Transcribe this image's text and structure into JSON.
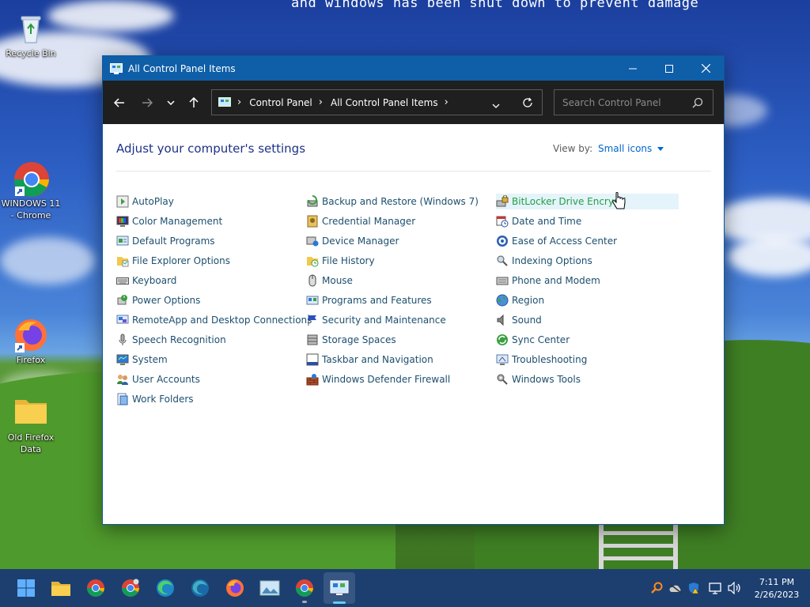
{
  "desktop": {
    "bsod_text": "and windows has been shut down to prevent damage",
    "icons": [
      {
        "label": "Recycle Bin"
      },
      {
        "label": "WINDOWS 11 - Chrome"
      },
      {
        "label": "Firefox"
      },
      {
        "label": "Old Firefox Data"
      }
    ]
  },
  "window": {
    "title": "All Control Panel Items",
    "breadcrumb": [
      "Control Panel",
      "All Control Panel Items"
    ],
    "search_placeholder": "Search Control Panel",
    "heading": "Adjust your computer's settings",
    "view_by_label": "View by:",
    "view_by_value": "Small icons",
    "columns": [
      [
        "AutoPlay",
        "Color Management",
        "Default Programs",
        "File Explorer Options",
        "Keyboard",
        "Power Options",
        "RemoteApp and Desktop Connections",
        "Speech Recognition",
        "System",
        "User Accounts",
        "Work Folders"
      ],
      [
        "Backup and Restore (Windows 7)",
        "Credential Manager",
        "Device Manager",
        "File History",
        "Mouse",
        "Programs and Features",
        "Security and Maintenance",
        "Storage Spaces",
        "Taskbar and Navigation",
        "Windows Defender Firewall"
      ],
      [
        "BitLocker Drive Encrypti",
        "Date and Time",
        "Ease of Access Center",
        "Indexing Options",
        "Phone and Modem",
        "Region",
        "Sound",
        "Sync Center",
        "Troubleshooting",
        "Windows Tools"
      ]
    ],
    "hover_item": "BitLocker Drive Encrypti"
  },
  "taskbar": {
    "time": "7:11 PM",
    "date": "2/26/2023"
  }
}
